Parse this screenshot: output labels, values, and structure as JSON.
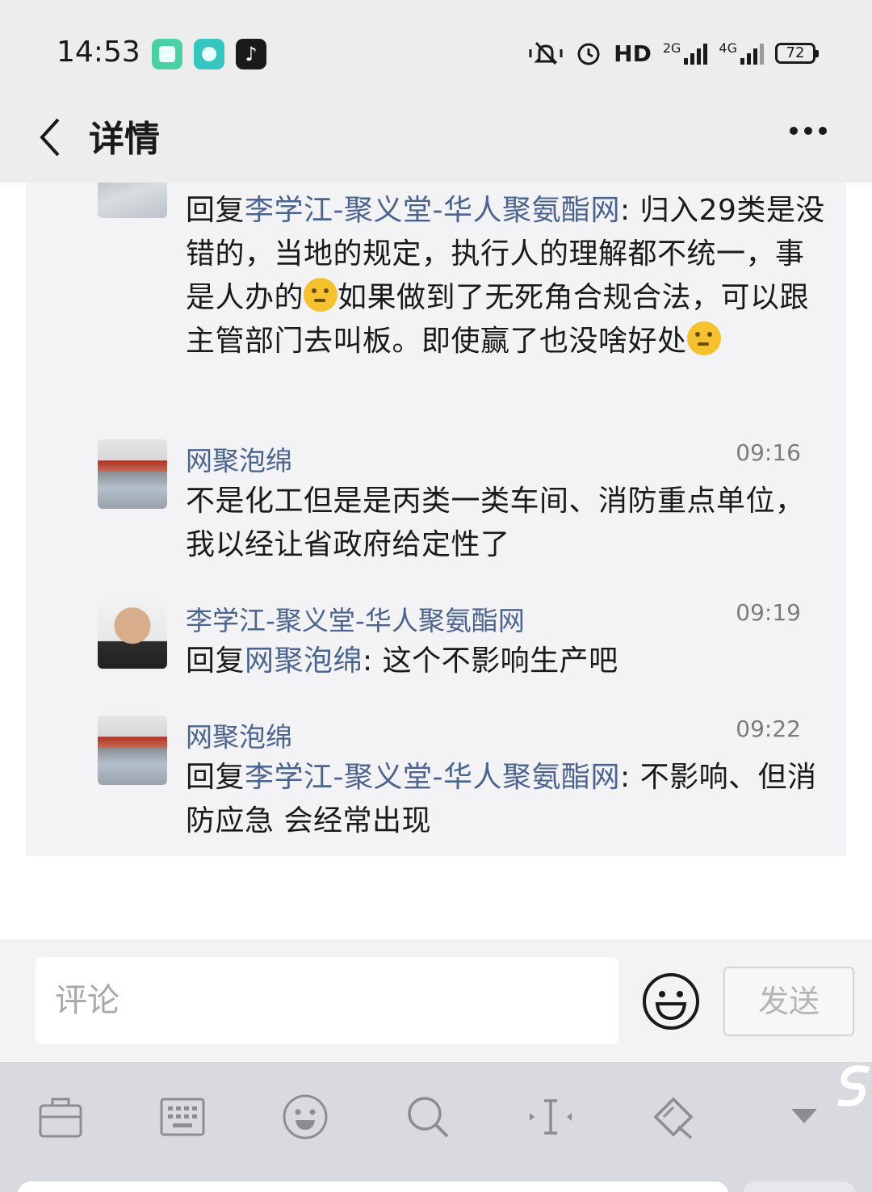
{
  "status_bar": {
    "time": "14:53",
    "network_hd": "HD",
    "network_2g": "2G",
    "network_4g": "4G",
    "battery": "72"
  },
  "header": {
    "title": "详情"
  },
  "comments": [
    {
      "name": "",
      "time": "",
      "reply_prefix": "回复",
      "reply_to": "李学江-聚义堂-华人聚氨酯网",
      "text_a": ": 归入29类是没错的，当地的规定，执行人的理解都不统一，事是人办的",
      "text_b": "如果做到了无死角合规合法，可以跟主管部门去叫板。即使赢了也没啥好处",
      "emoji_name": "thinking-face"
    },
    {
      "name": "网聚泡绵",
      "time": "09:16",
      "text": "不是化工但是是丙类一类车间、消防重点单位，我以经让省政府给定性了"
    },
    {
      "name": "李学江-聚义堂-华人聚氨酯网",
      "time": "09:19",
      "reply_prefix": "回复",
      "reply_to": "网聚泡绵",
      "text": ": 这个不影响生产吧"
    },
    {
      "name": "网聚泡绵",
      "time": "09:22",
      "reply_prefix": "回复",
      "reply_to": "李学江-聚义堂-华人聚氨酯网",
      "text": ": 不影响、但消防应急 会经常出现"
    }
  ],
  "input_bar": {
    "placeholder": "评论",
    "send_label": "发送"
  },
  "keyboard_toolbar": {
    "icons": [
      "toolbox-icon",
      "keyboard-icon",
      "emoji-icon",
      "search-icon",
      "cursor-icon",
      "clipboard-edit-icon",
      "collapse-keyboard-icon"
    ]
  },
  "colors": {
    "link": "#4b648f",
    "panel_bg": "#f3f3f5",
    "header_bg": "#ededed",
    "keyboard_bg": "#d9dadf"
  }
}
